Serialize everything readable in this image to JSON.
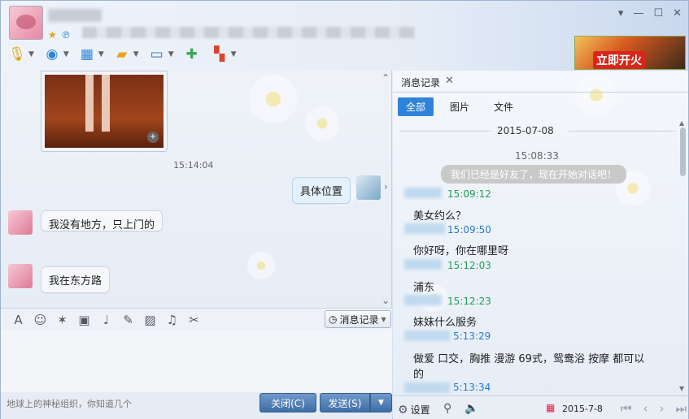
{
  "window": {
    "controls": [
      "▾",
      "—",
      "☐",
      "✕"
    ]
  },
  "ad": {
    "label": "立即开火"
  },
  "chat": {
    "time1": "15:14:04",
    "my_bubble": "具体位置",
    "msg1": "我没有地方，只上门的",
    "msg2": "我在东方路"
  },
  "input_toolbar": {
    "msg_log_label": "消息记录"
  },
  "footer": {
    "hint": "地球上的神秘组织，你知道几个",
    "close_label": "关闭(C)",
    "send_label": "发送(S)"
  },
  "history": {
    "tab_label": "消息记录",
    "filters": [
      "全部",
      "图片",
      "文件"
    ],
    "date_header": "2015-07-08",
    "first_time": "15:08:33",
    "system_msg": "我们已经是好友了，现在开始对话吧！",
    "entries": [
      {
        "time": "15:09:12",
        "text": "美女约么？"
      },
      {
        "time": "15:09:50",
        "text": "你好呀，你在哪里呀"
      },
      {
        "time": "15:12:03",
        "text": "浦东"
      },
      {
        "time": "15:12:23",
        "text": "妹妹什么服务"
      },
      {
        "time": "5:13:29",
        "text": "做爱 口交，胸推 漫游 69式，鸳鸯浴   按摩 都可以"
      },
      {
        "time": "",
        "text": "的"
      },
      {
        "time": "5:13:34",
        "text": ""
      }
    ],
    "settings_label": "设置",
    "footer_date": "2015-7-8"
  }
}
